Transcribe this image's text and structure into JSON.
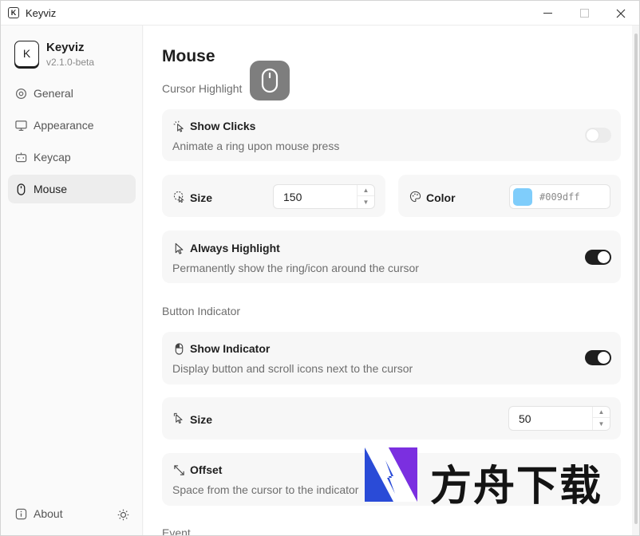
{
  "window": {
    "title": "Keyviz",
    "logo_letter": "K"
  },
  "sidebar": {
    "app_name": "Keyviz",
    "version": "v2.1.0-beta",
    "items": [
      {
        "label": "General",
        "icon": "gear-icon"
      },
      {
        "label": "Appearance",
        "icon": "monitor-icon"
      },
      {
        "label": "Keycap",
        "icon": "keycap-icon"
      },
      {
        "label": "Mouse",
        "icon": "mouse-icon",
        "active": true
      }
    ],
    "about_label": "About"
  },
  "main": {
    "title": "Mouse",
    "sections": {
      "cursor_highlight": "Cursor Highlight",
      "button_indicator": "Button Indicator",
      "event": "Event"
    },
    "show_clicks": {
      "title": "Show Clicks",
      "desc": "Animate a ring upon mouse press",
      "enabled": false
    },
    "size": {
      "label": "Size",
      "value": "150"
    },
    "color": {
      "label": "Color",
      "value": "#009dff",
      "swatch": "#7fcdfb"
    },
    "always_highlight": {
      "title": "Always Highlight",
      "desc": "Permanently show the ring/icon around the cursor",
      "enabled": true
    },
    "show_indicator": {
      "title": "Show Indicator",
      "desc": "Display button and scroll icons next to the cursor",
      "enabled": true
    },
    "indicator_size": {
      "label": "Size",
      "value": "50"
    },
    "offset": {
      "title": "Offset",
      "desc": "Space from the cursor to the indicator"
    }
  },
  "watermark": {
    "text": "方舟下载"
  },
  "colors": {
    "accent": "#1f1f1f",
    "card_bg": "#f7f7f7"
  }
}
